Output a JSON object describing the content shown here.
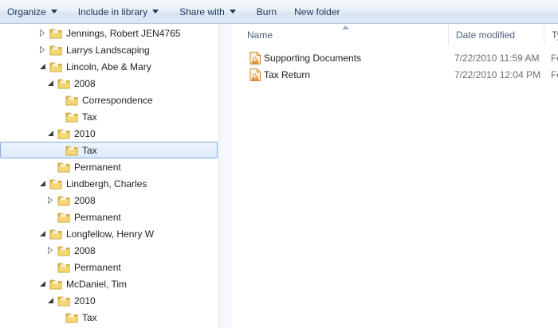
{
  "toolbar": {
    "organize": "Organize",
    "include_in_library": "Include in library",
    "share_with": "Share with",
    "burn": "Burn",
    "new_folder": "New folder"
  },
  "nav_tree": [
    {
      "label": "Jennings, Robert  JEN4765",
      "level": 0,
      "expander": "collapsed"
    },
    {
      "label": "Larrys Landscaping",
      "level": 0,
      "expander": "collapsed"
    },
    {
      "label": "Lincoln, Abe & Mary",
      "level": 0,
      "expander": "expanded"
    },
    {
      "label": "2008",
      "level": 1,
      "expander": "expanded"
    },
    {
      "label": "Correspondence",
      "level": 2,
      "expander": "none"
    },
    {
      "label": "Tax",
      "level": 2,
      "expander": "none"
    },
    {
      "label": "2010",
      "level": 1,
      "expander": "expanded"
    },
    {
      "label": "Tax",
      "level": 2,
      "expander": "none",
      "selected": true
    },
    {
      "label": "Permanent",
      "level": 1,
      "expander": "none"
    },
    {
      "label": "Lindbergh, Charles",
      "level": 0,
      "expander": "expanded"
    },
    {
      "label": "2008",
      "level": 1,
      "expander": "collapsed"
    },
    {
      "label": "Permanent",
      "level": 1,
      "expander": "none"
    },
    {
      "label": "Longfellow, Henry W",
      "level": 0,
      "expander": "expanded"
    },
    {
      "label": "2008",
      "level": 1,
      "expander": "collapsed"
    },
    {
      "label": "Permanent",
      "level": 1,
      "expander": "none"
    },
    {
      "label": "McDaniel, Tim",
      "level": 0,
      "expander": "expanded"
    },
    {
      "label": "2010",
      "level": 1,
      "expander": "expanded"
    },
    {
      "label": "Tax",
      "level": 2,
      "expander": "none"
    },
    {
      "label": "",
      "level": 2,
      "expander": "none"
    }
  ],
  "columns": {
    "name": "Name",
    "date_modified": "Date modified",
    "type": "Ty"
  },
  "files": [
    {
      "name": "Supporting Documents",
      "date": "7/22/2010 11:59 AM",
      "type": "Fo",
      "icon": "pdf-file-icon"
    },
    {
      "name": "Tax Return",
      "date": "7/22/2010 12:04 PM",
      "type": "Fo",
      "icon": "pdf-file-icon"
    }
  ],
  "colors": {
    "toolbar_text": "#1e395b",
    "selection_border": "#84acdd",
    "folder_yellow": "#f1cd63",
    "pdf_icon": "#d9892a"
  }
}
